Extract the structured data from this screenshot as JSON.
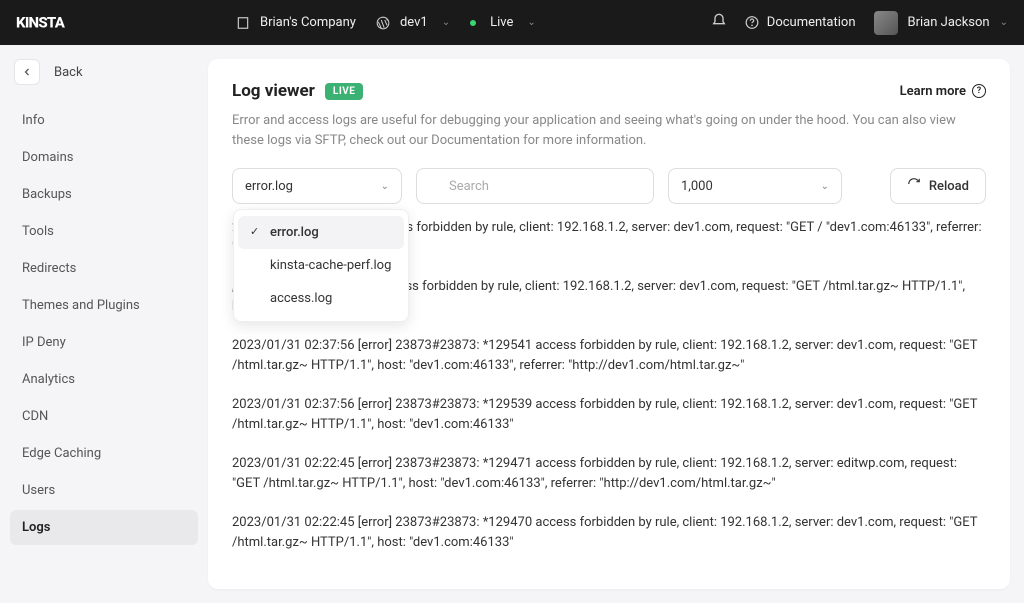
{
  "topbar": {
    "company": "Brian's Company",
    "site": "dev1",
    "env_label": "Live",
    "documentation": "Documentation",
    "user_name": "Brian Jackson"
  },
  "back_label": "Back",
  "nav_items": [
    "Info",
    "Domains",
    "Backups",
    "Tools",
    "Redirects",
    "Themes and Plugins",
    "IP Deny",
    "Analytics",
    "CDN",
    "Edge Caching",
    "Users",
    "Logs"
  ],
  "nav_active": "Logs",
  "page": {
    "title": "Log viewer",
    "badge": "LIVE",
    "learn_more": "Learn more",
    "description": "Error and access logs are useful for debugging your application and seeing what's going on under the hood. You can also view these logs via SFTP, check out our Documentation for more information."
  },
  "controls": {
    "log_select_value": "error.log",
    "log_select_options": [
      "error.log",
      "kinsta-cache-perf.log",
      "access.log"
    ],
    "search_placeholder": "Search",
    "count_value": "1,000",
    "reload_label": "Reload"
  },
  "logs": [
    "23873#23873: *129596 access forbidden by rule, client: 192.168.1.2, server: dev1.com, request: \"GET / \"dev1.com:46133\", referrer: \"http://dev1.com/html.tar.gz~\"",
    ", 23873#23873: *129594 access forbidden by rule, client: 192.168.1.2, server: dev1.com, request: \"GET /html.tar.gz~ HTTP/1.1\", host: \"dev1.com:46133\"",
    "2023/01/31 02:37:56 [error] 23873#23873: *129541 access forbidden by rule, client: 192.168.1.2, server: dev1.com, request: \"GET /html.tar.gz~ HTTP/1.1\", host: \"dev1.com:46133\", referrer: \"http://dev1.com/html.tar.gz~\"",
    "2023/01/31 02:37:56 [error] 23873#23873: *129539 access forbidden by rule, client: 192.168.1.2, server: dev1.com, request: \"GET /html.tar.gz~ HTTP/1.1\", host: \"dev1.com:46133\"",
    "2023/01/31 02:22:45 [error] 23873#23873: *129471 access forbidden by rule, client: 192.168.1.2, server: editwp.com, request: \"GET /html.tar.gz~ HTTP/1.1\", host: \"dev1.com:46133\", referrer: \"http://dev1.com/html.tar.gz~\"",
    "2023/01/31 02:22:45 [error] 23873#23873: *129470 access forbidden by rule, client: 192.168.1.2, server: dev1.com, request: \"GET /html.tar.gz~ HTTP/1.1\", host: \"dev1.com:46133\""
  ]
}
